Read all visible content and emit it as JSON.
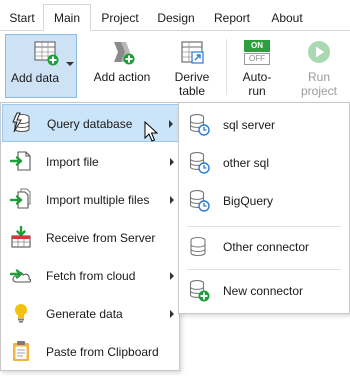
{
  "tabs": [
    {
      "label": "Start",
      "active": false
    },
    {
      "label": "Main",
      "active": true
    },
    {
      "label": "Project",
      "active": false
    },
    {
      "label": "Design",
      "active": false
    },
    {
      "label": "Report",
      "active": false
    },
    {
      "label": "About",
      "active": false
    }
  ],
  "ribbon": {
    "add_data": {
      "label": "Add data",
      "icon": "add-data-icon"
    },
    "add_action": {
      "label": "Add action",
      "icon": "add-action-icon"
    },
    "derive_table": {
      "label_line1": "Derive",
      "label_line2": "table",
      "icon": "derive-table-icon"
    },
    "auto_run": {
      "label_line1": "Auto-",
      "label_line2": "run",
      "toggle_on": "ON",
      "toggle_off": "OFF",
      "icon": "auto-run-toggle-icon"
    },
    "run_project": {
      "label_line1": "Run",
      "label_line2": "project",
      "icon": "play-icon",
      "disabled": true
    }
  },
  "menu": {
    "items": [
      {
        "label": "Query database",
        "icon": "database-bolt-icon",
        "has_submenu": true,
        "highlighted": true
      },
      {
        "label": "Import file",
        "icon": "import-file-icon",
        "has_submenu": true
      },
      {
        "label": "Import multiple files",
        "icon": "import-multiple-files-icon",
        "has_submenu": true
      },
      {
        "label": "Receive from Server",
        "icon": "receive-from-server-icon",
        "has_submenu": false
      },
      {
        "label": "Fetch from cloud",
        "icon": "cloud-fetch-icon",
        "has_submenu": true
      },
      {
        "label": "Generate data",
        "icon": "lightbulb-icon",
        "has_submenu": true
      },
      {
        "label": "Paste from Clipboard",
        "icon": "clipboard-icon",
        "has_submenu": false
      }
    ]
  },
  "submenu": {
    "items": [
      {
        "label": "sql server",
        "icon": "database-clock-icon"
      },
      {
        "label": "other sql",
        "icon": "database-clock-icon"
      },
      {
        "label": "BigQuery",
        "icon": "database-clock-icon"
      },
      {
        "label": "Other connector",
        "icon": "database-icon"
      },
      {
        "label": "New connector",
        "icon": "database-add-icon"
      }
    ]
  },
  "colors": {
    "accent_green": "#1e9e3a",
    "highlight_bg": "#cce4f7",
    "highlight_border": "#9cc8ee",
    "active_button_bg": "#cde3f5",
    "toggle_green": "#2e9e3e"
  }
}
